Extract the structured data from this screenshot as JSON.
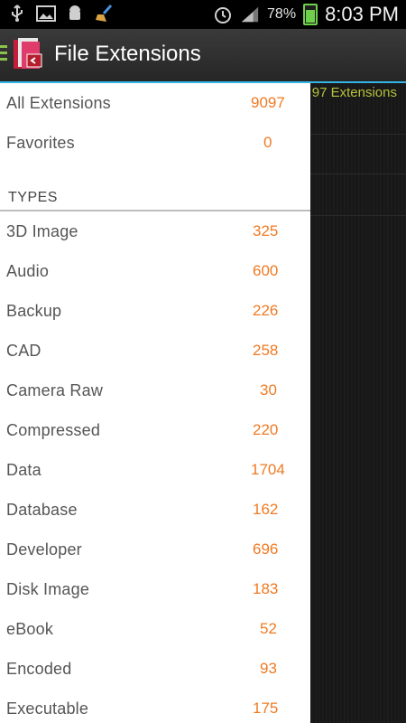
{
  "status_bar": {
    "battery_pct": "78%",
    "time": "8:03 PM"
  },
  "action_bar": {
    "title": "File Extensions"
  },
  "background": {
    "count_text": "97 Extensions"
  },
  "drawer": {
    "top_items": [
      {
        "label": "All Extensions",
        "count": "9097"
      },
      {
        "label": "Favorites",
        "count": "0"
      }
    ],
    "section_title": "TYPES",
    "types": [
      {
        "label": "3D Image",
        "count": "325"
      },
      {
        "label": "Audio",
        "count": "600"
      },
      {
        "label": "Backup",
        "count": "226"
      },
      {
        "label": "CAD",
        "count": "258"
      },
      {
        "label": "Camera Raw",
        "count": "30"
      },
      {
        "label": "Compressed",
        "count": "220"
      },
      {
        "label": "Data",
        "count": "1704"
      },
      {
        "label": "Database",
        "count": "162"
      },
      {
        "label": "Developer",
        "count": "696"
      },
      {
        "label": "Disk Image",
        "count": "183"
      },
      {
        "label": "eBook",
        "count": "52"
      },
      {
        "label": "Encoded",
        "count": "93"
      },
      {
        "label": "Executable",
        "count": "175"
      }
    ]
  },
  "colors": {
    "accent_blue": "#33b5e5",
    "count_orange": "#f07a22",
    "bg_count_olive": "#b5c33b"
  }
}
